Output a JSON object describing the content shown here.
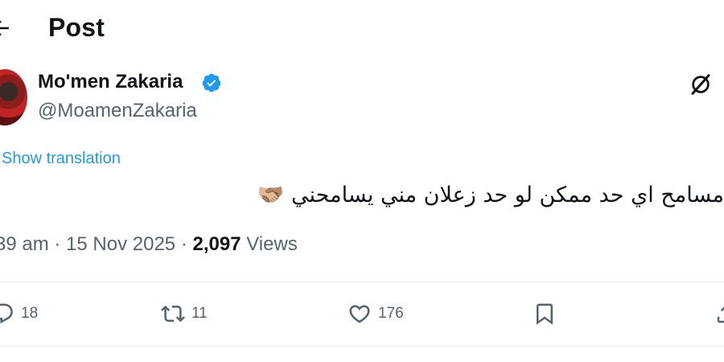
{
  "header": {
    "title": "Post"
  },
  "author": {
    "name": "Mo'men Zakaria",
    "handle": "@MoamenZakaria"
  },
  "tweet": {
    "show_translation": "Show translation",
    "text": "مسامح اي حد ممكن لو حد زعلان مني يسامحني 🫱🏼‍🫲🏽",
    "time": "39 am",
    "separator1": "·",
    "date": "15 Nov 2025",
    "separator2": "·",
    "views_count": "2,097",
    "views_label": "Views"
  },
  "actions": {
    "replies": "18",
    "retweets": "11",
    "likes": "176"
  },
  "colors": {
    "accent": "#1d9bf0",
    "muted": "#536471",
    "text": "#0f1419"
  }
}
